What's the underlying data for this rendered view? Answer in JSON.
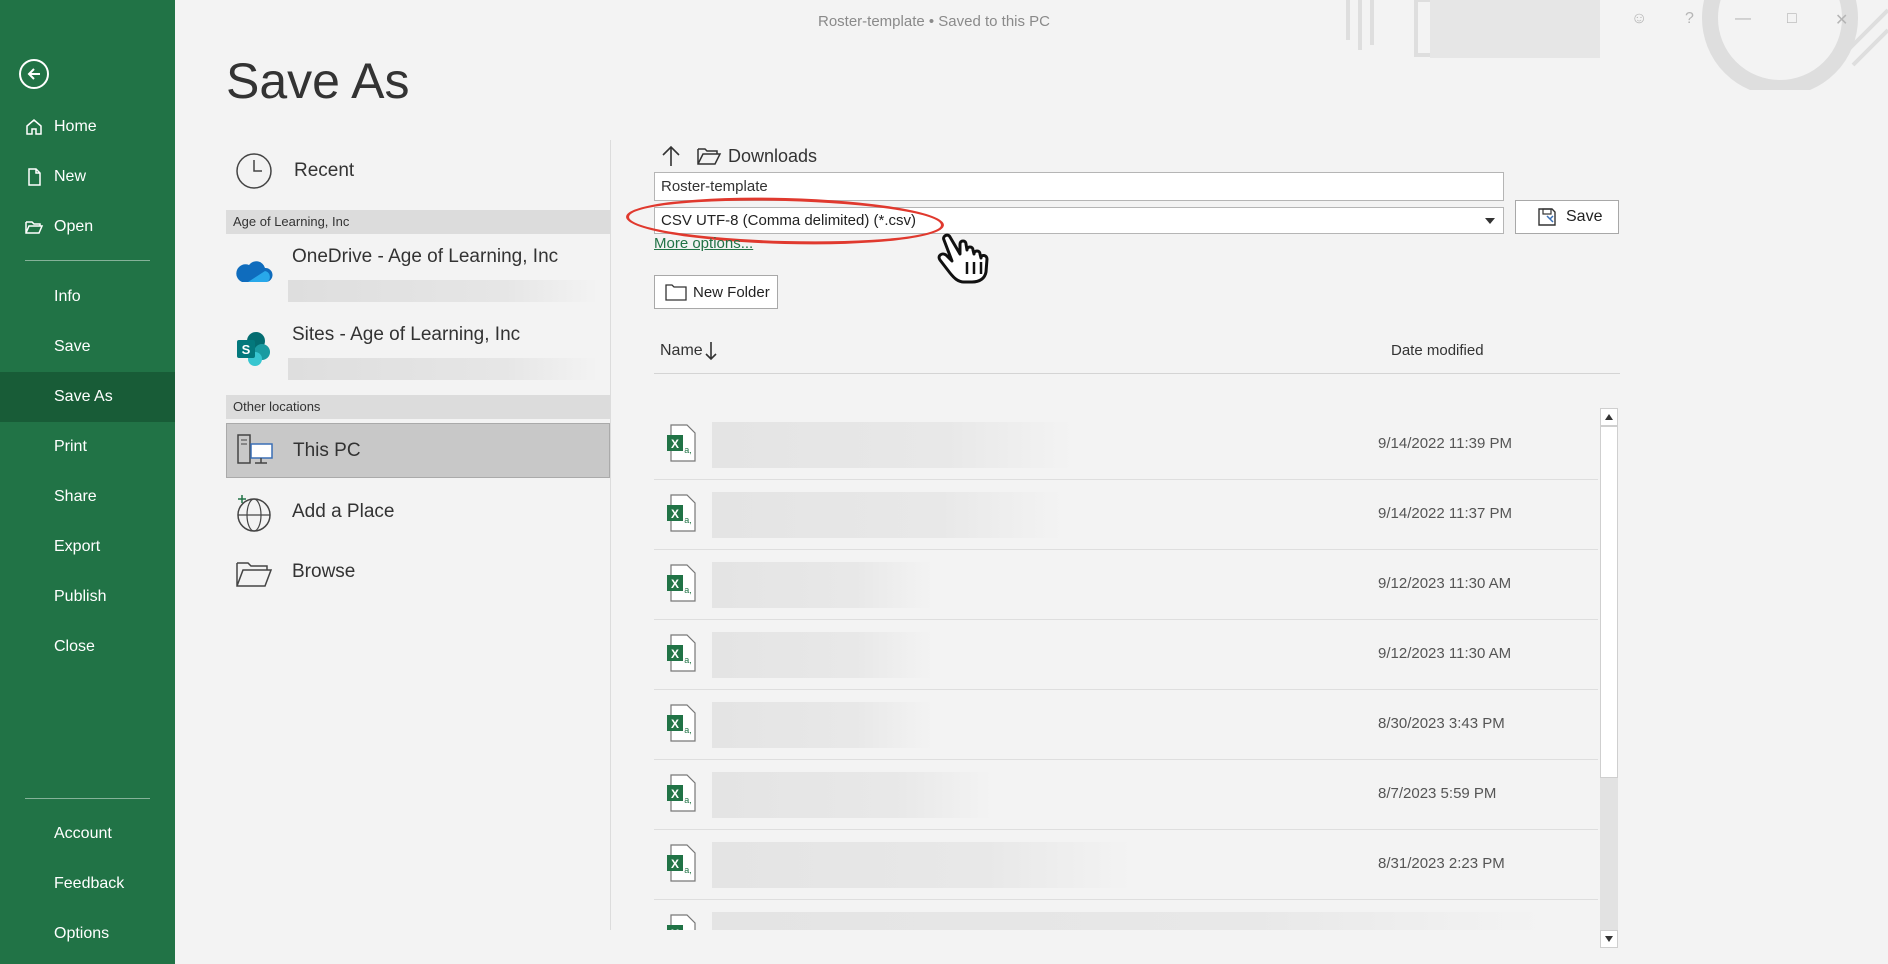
{
  "window": {
    "doc_title": "Roster-template  •  Saved to this PC"
  },
  "sidebar": {
    "items": [
      {
        "label": "Home",
        "icon": "home-icon"
      },
      {
        "label": "New",
        "icon": "new-document-icon"
      },
      {
        "label": "Open",
        "icon": "open-folder-icon"
      },
      {
        "label": "Info"
      },
      {
        "label": "Save"
      },
      {
        "label": "Save As",
        "active": true
      },
      {
        "label": "Print"
      },
      {
        "label": "Share"
      },
      {
        "label": "Export"
      },
      {
        "label": "Publish"
      },
      {
        "label": "Close"
      }
    ],
    "bottom_items": [
      {
        "label": "Account"
      },
      {
        "label": "Feedback"
      },
      {
        "label": "Options"
      }
    ],
    "accent_color": "#217346",
    "active_color": "#185c37"
  },
  "page": {
    "title": "Save As"
  },
  "locations": {
    "recent": "Recent",
    "group1_header": "Age of Learning, Inc",
    "onedrive": "OneDrive - Age of Learning, Inc",
    "sites": "Sites - Age of Learning, Inc",
    "group2_header": "Other locations",
    "this_pc": "This PC",
    "add_place": "Add a Place",
    "browse": "Browse"
  },
  "save_pane": {
    "current_folder": "Downloads",
    "filename_value": "Roster-template",
    "filetype_selected": "CSV UTF-8 (Comma delimited) (*.csv)",
    "more_options": "More options...",
    "save_label": "Save",
    "new_folder_label": "New Folder",
    "col_name": "Name",
    "col_date": "Date modified",
    "highlight_color": "#e0392e"
  },
  "files": [
    {
      "date": "9/14/2022 11:39 PM"
    },
    {
      "date": "9/14/2022 11:37 PM"
    },
    {
      "date": "9/12/2023 11:30 AM"
    },
    {
      "date": "9/12/2023 11:30 AM"
    },
    {
      "date": "8/30/2023 3:43 PM"
    },
    {
      "date": "8/7/2023 5:59 PM"
    },
    {
      "date": "8/31/2023 2:23 PM"
    },
    {
      "date": ""
    }
  ]
}
